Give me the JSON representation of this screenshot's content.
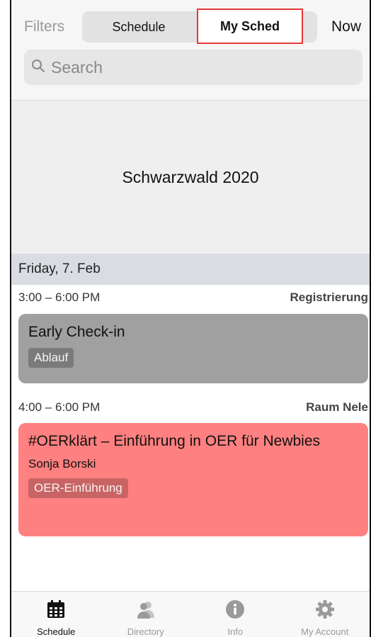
{
  "topbar": {
    "filters_label": "Filters",
    "segments": [
      "Schedule",
      "My Sched"
    ],
    "selected_segment": "My Sched",
    "now_label": "Now"
  },
  "search": {
    "placeholder": "Search"
  },
  "hero": {
    "title": "Schwarzwald 2020"
  },
  "day": {
    "label": "Friday, 7. Feb"
  },
  "sessions": [
    {
      "time": "3:00 – 6:00 PM",
      "location": "Registrierung",
      "title": "Early Check-in",
      "speaker": "",
      "tag": "Ablauf",
      "color": "#a0a0a0"
    },
    {
      "time": "4:00 – 6:00 PM",
      "location": "Raum Nele",
      "title": "#OERklärt – Einführung in OER für Newbies",
      "speaker": "Sonja Borski",
      "tag": "OER-Einführung",
      "color": "#ff8080"
    }
  ],
  "tabs": [
    {
      "label": "Schedule",
      "icon": "calendar-icon",
      "active": true
    },
    {
      "label": "Directory",
      "icon": "people-icon",
      "active": false
    },
    {
      "label": "Info",
      "icon": "info-icon",
      "active": false
    },
    {
      "label": "My Account",
      "icon": "gear-icon",
      "active": false
    }
  ],
  "colors": {
    "highlight_border": "#e53935",
    "day_header_bg": "#d9dde3"
  }
}
